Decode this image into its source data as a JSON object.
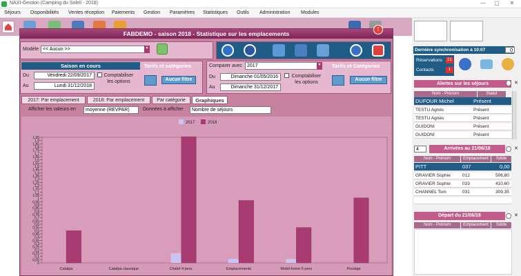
{
  "app": {
    "title": "NAXI-Gestion (Camping du Soleil - 2018)",
    "min": "—",
    "max": "▢",
    "close": "✕"
  },
  "menu": [
    "Séjours",
    "Disponibilités",
    "Ventes réception",
    "Paiements",
    "Gestion",
    "Paramètres",
    "Statistiques",
    "Outils",
    "Administration",
    "Modules"
  ],
  "window": {
    "title": "FABDEMO - saison 2018 - Statistique sur les emplacements",
    "modele_label": "Modèle",
    "modele_value": "<< Aucun >>"
  },
  "season": {
    "header": "Saison en cours",
    "du_label": "Du",
    "du_value": "Vendredi 22/09/2017",
    "au_label": "Au",
    "au_value": "Lundi 31/12/2018",
    "option_label": "Comptabiliser les options",
    "tarifs_header": "Tarifs et catégories",
    "filter_button": "Aucun filtre"
  },
  "compare": {
    "label": "Comparer avec",
    "value": "2017",
    "du_label": "Du",
    "du_value": "Dimanche 01/05/2016",
    "au_label": "Au",
    "au_value": "Dimanche 31/12/2017",
    "option_label": "Comptabiliser les options",
    "tarifs_header": "Tarifs et Catégories",
    "filter_button": "Aucun filtre"
  },
  "tabs": [
    "2017: Par emplacement",
    "2018: Par emplacement",
    "Par catégorie",
    "Graphiques"
  ],
  "active_tab": 3,
  "chart_controls": {
    "afficher_label": "Afficher les valeurs en",
    "afficher_value": "moyenne (REVPAR)",
    "donnees_label": "Données à afficher",
    "donnees_value": "Nombre de séjours"
  },
  "chart_data": {
    "type": "bar",
    "categories": [
      "Catalpa",
      "Catalpa classique",
      "Chalet 4 pers.",
      "Emplacements",
      "Mobil-home 6 pers",
      "Prestige"
    ],
    "series": [
      {
        "name": "2017",
        "values": [
          0,
          0,
          0.15,
          0.06,
          0.06,
          0
        ],
        "color": "#c9c4f4"
      },
      {
        "name": "2018",
        "values": [
          0.5,
          0,
          1.96,
          0.97,
          0.55,
          1.01
        ],
        "color": "#a83b72"
      }
    ],
    "yticks": [
      0,
      0.05,
      0.1,
      0.15,
      0.2,
      0.25,
      0.3,
      0.35,
      0.4,
      0.45,
      0.5,
      0.55,
      0.6,
      0.65,
      0.7,
      0.75,
      0.8,
      0.85,
      0.9,
      0.95,
      1,
      1.05,
      1.1,
      1.15,
      1.2,
      1.25,
      1.3,
      1.35,
      1.4,
      1.45,
      1.5,
      1.55,
      1.6,
      1.65,
      1.7,
      1.75,
      1.8,
      1.85,
      1.9,
      1.95
    ],
    "ytick_labels": [
      "0",
      "0,05",
      "0,1",
      "0,15",
      "0,2",
      "0,25",
      "0,3",
      "0,35",
      "0,4",
      "0,45",
      "0,5",
      "0,55",
      "0,6",
      "0,65",
      "0,7",
      "0,75",
      "0,8",
      "0,85",
      "0,9",
      "0,95",
      "1",
      "1,05",
      "1,1",
      "1,15",
      "1,2",
      "1,25",
      "1,3",
      "1,35",
      "1,4",
      "1,45",
      "1,5",
      "1,55",
      "1,6",
      "1,65",
      "1,7",
      "1,75",
      "1,8",
      "1,85",
      "1,9",
      "1,95"
    ],
    "ylim": [
      0,
      1.95
    ],
    "legend": "top-center",
    "grid": false
  },
  "right_panel": {
    "sync": "Dernière synchronisation à 10:07",
    "sync_count": "0",
    "reservations_label": "Réservations",
    "reservations_count": "21",
    "contacts_label": "Contacts",
    "contacts_count": "1",
    "alerts_header": "Alertes sur les séjours",
    "alerts_cols": [
      "Nom - Prénom",
      "Statut"
    ],
    "alerts_group": "DUFOUR Michel",
    "alerts_group_status": "Présent",
    "alerts": [
      {
        "name": "TESTU Agnès",
        "status": "Présent"
      },
      {
        "name": "TESTU Agnès",
        "status": "Présent"
      },
      {
        "name": "GUIDONI",
        "status": "Présent"
      },
      {
        "name": "GUIDONI",
        "status": "Présent"
      }
    ],
    "arrivals_count": "4",
    "arrivals_header": "Arrivées au 21/06/18",
    "arrivals_cols": [
      "Nom - Prénom",
      "Emplacement",
      "Solde"
    ],
    "arrivals": [
      {
        "name": "PITT",
        "place": "037",
        "solde": "0,00"
      },
      {
        "name": "GRAVIER Sophie",
        "place": "012",
        "solde": "506,80"
      },
      {
        "name": "GRAVIER Sophie",
        "place": "033",
        "solde": "410,60"
      },
      {
        "name": "CHANNEL Tom",
        "place": "031",
        "solde": "309,35"
      }
    ],
    "departures_header": "Départ du 21/06/18",
    "departures_cols": [
      "Nom - Prénom",
      "Emplacement",
      "Solde"
    ]
  }
}
